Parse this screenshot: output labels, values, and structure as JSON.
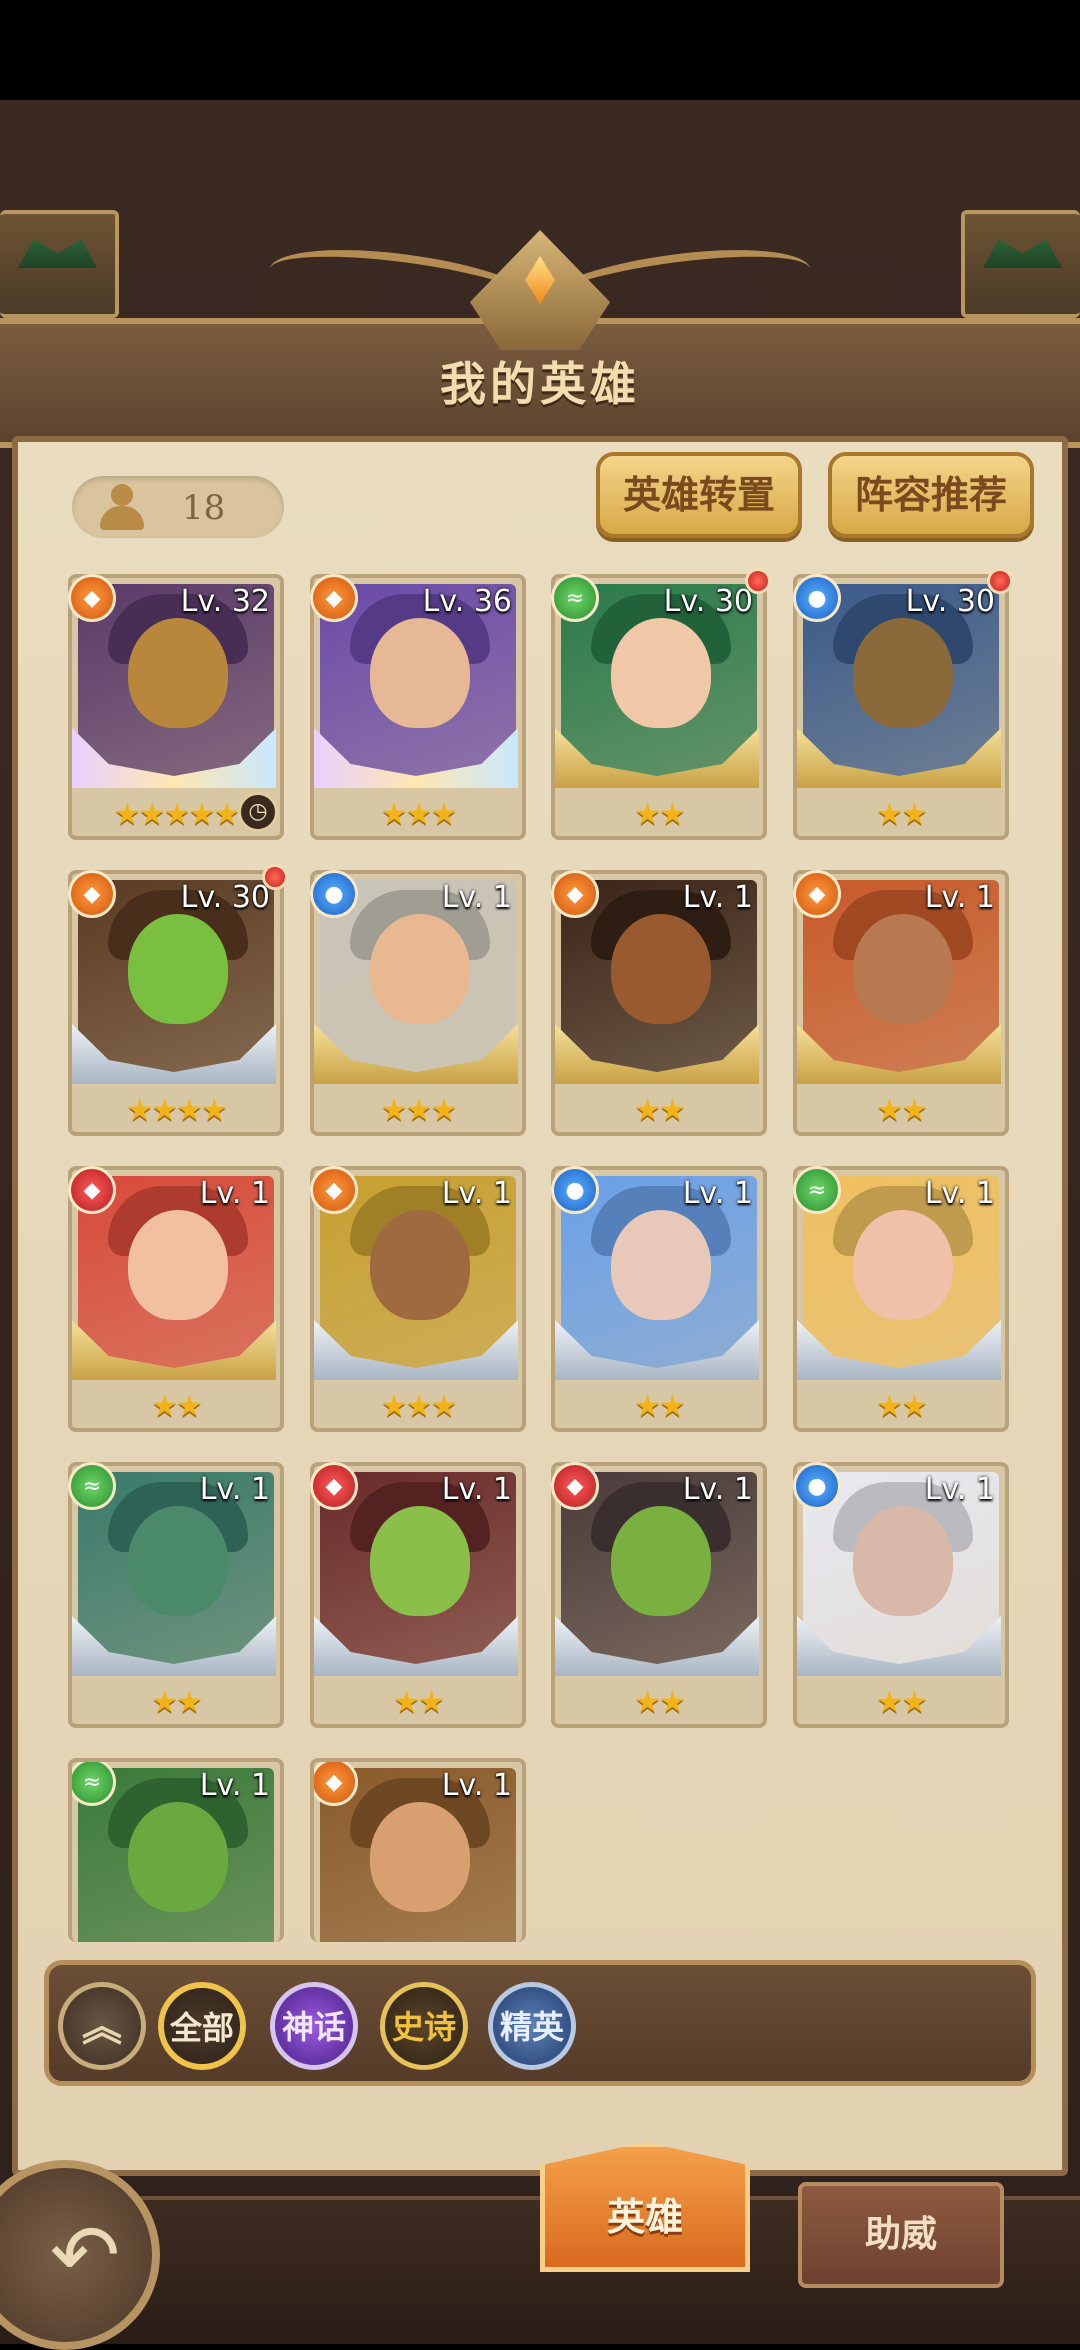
{
  "title": "我的英雄",
  "hero_count": "18",
  "buttons": {
    "convert": "英雄转置",
    "recommend": "阵容推荐"
  },
  "heroes": [
    {
      "level": "Lv. 32",
      "stars": "★★★★★",
      "element": "fire",
      "element_icon": "◆",
      "banner": "rainbow",
      "colors": [
        "#5a3a6a",
        "#b8873c"
      ],
      "dot": false,
      "clock": true
    },
    {
      "level": "Lv. 36",
      "stars": "★★★",
      "element": "fire",
      "element_icon": "◆",
      "banner": "rainbow",
      "colors": [
        "#6a4aa8",
        "#e6b896"
      ],
      "dot": false,
      "clock": false
    },
    {
      "level": "Lv. 30",
      "stars": "★★",
      "element": "nature",
      "element_icon": "≈",
      "banner": "gold",
      "colors": [
        "#2a7a4a",
        "#f0c8a8"
      ],
      "dot": true,
      "clock": false
    },
    {
      "level": "Lv. 30",
      "stars": "★★",
      "element": "water",
      "element_icon": "●",
      "banner": "gold",
      "colors": [
        "#3a5a8a",
        "#8a6a3a"
      ],
      "dot": true,
      "clock": false
    },
    {
      "level": "Lv. 30",
      "stars": "★★★★",
      "element": "fire",
      "element_icon": "◆",
      "banner": "silver",
      "colors": [
        "#5a3a22",
        "#7ac040"
      ],
      "dot": true,
      "clock": false
    },
    {
      "level": "Lv. 1",
      "stars": "★★★",
      "element": "water",
      "element_icon": "●",
      "banner": "gold",
      "colors": [
        "#c8c4b8",
        "#e8b890"
      ],
      "dot": false,
      "clock": false
    },
    {
      "level": "Lv. 1",
      "stars": "★★",
      "element": "fire",
      "element_icon": "◆",
      "banner": "gold",
      "colors": [
        "#3a2418",
        "#9a5a30"
      ],
      "dot": false,
      "clock": false
    },
    {
      "level": "Lv. 1",
      "stars": "★★",
      "element": "fire",
      "element_icon": "◆",
      "banner": "gold",
      "colors": [
        "#c85a2a",
        "#b87850"
      ],
      "dot": false,
      "clock": false
    },
    {
      "level": "Lv. 1",
      "stars": "★★",
      "element": "flame",
      "element_icon": "◆",
      "banner": "gold",
      "colors": [
        "#d84a3a",
        "#f0c0a0"
      ],
      "dot": false,
      "clock": false
    },
    {
      "level": "Lv. 1",
      "stars": "★★★",
      "element": "fire",
      "element_icon": "◆",
      "banner": "silver",
      "colors": [
        "#c8a030",
        "#a06a40"
      ],
      "dot": false,
      "clock": false
    },
    {
      "level": "Lv. 1",
      "stars": "★★",
      "element": "water",
      "element_icon": "●",
      "banner": "silver",
      "colors": [
        "#6aa0e8",
        "#e8c8b8"
      ],
      "dot": false,
      "clock": false
    },
    {
      "level": "Lv. 1",
      "stars": "★★",
      "element": "nature",
      "element_icon": "≈",
      "banner": "silver",
      "colors": [
        "#f0c060",
        "#f0c0a8"
      ],
      "dot": false,
      "clock": false
    },
    {
      "level": "Lv. 1",
      "stars": "★★",
      "element": "nature",
      "element_icon": "≈",
      "banner": "silver",
      "colors": [
        "#3a7a6a",
        "#4a8a6a"
      ],
      "dot": false,
      "clock": false
    },
    {
      "level": "Lv. 1",
      "stars": "★★",
      "element": "flame",
      "element_icon": "◆",
      "banner": "silver",
      "colors": [
        "#6a2a2a",
        "#8ac04a"
      ],
      "dot": false,
      "clock": false
    },
    {
      "level": "Lv. 1",
      "stars": "★★",
      "element": "flame",
      "element_icon": "◆",
      "banner": "silver",
      "colors": [
        "#4a3a3a",
        "#7ab040"
      ],
      "dot": false,
      "clock": false
    },
    {
      "level": "Lv. 1",
      "stars": "★★",
      "element": "water",
      "element_icon": "●",
      "banner": "silver",
      "colors": [
        "#e8e8f0",
        "#d8b8a8"
      ],
      "dot": false,
      "clock": false
    },
    {
      "level": "Lv. 1",
      "stars": "",
      "element": "nature",
      "element_icon": "≈",
      "banner": "none",
      "colors": [
        "#3a7a3a",
        "#6aa840"
      ],
      "dot": false,
      "clock": false
    },
    {
      "level": "Lv. 1",
      "stars": "",
      "element": "fire",
      "element_icon": "◆",
      "banner": "none",
      "colors": [
        "#8a5a2a",
        "#d8a070"
      ],
      "dot": false,
      "clock": false
    }
  ],
  "filters": {
    "collapse_icon": "︽",
    "all": "全部",
    "myth": "神话",
    "epic": "史诗",
    "elite": "精英"
  },
  "tabs": {
    "heroes": "英雄",
    "support": "助威"
  },
  "back_icon": "↶"
}
